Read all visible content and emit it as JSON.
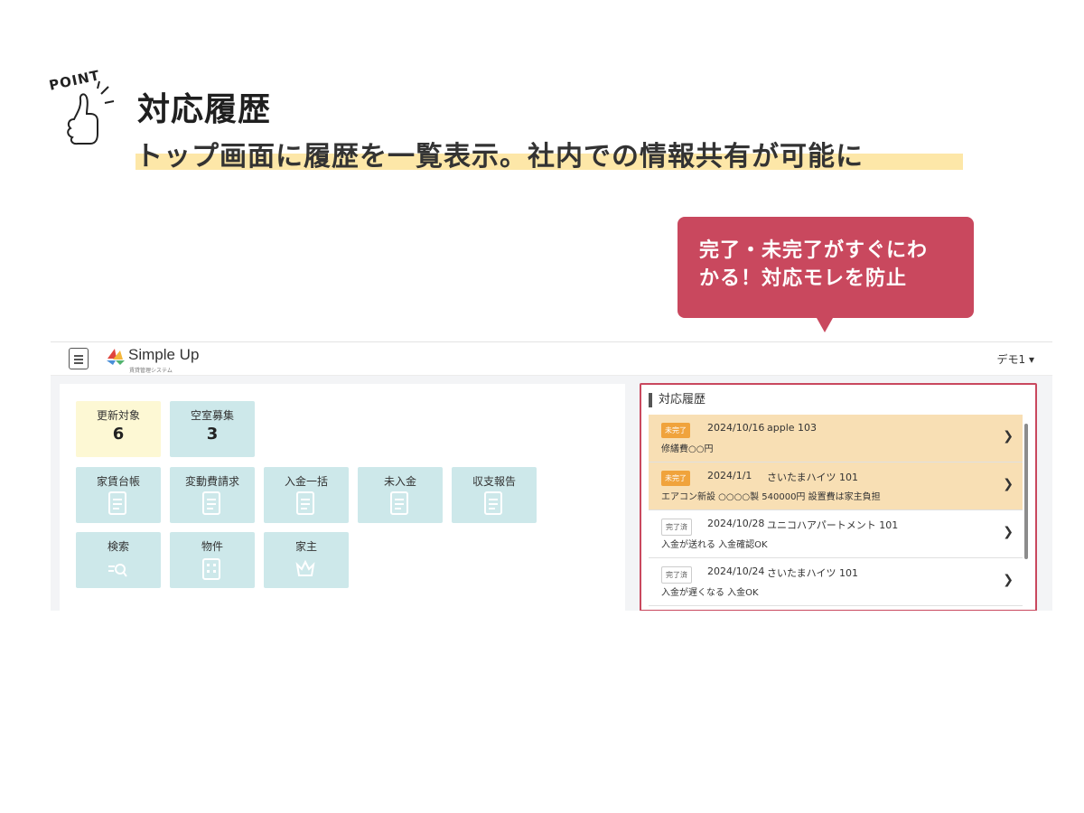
{
  "header": {
    "point_label": "POINT",
    "title": "対応履歴",
    "subtitle": "トップ画面に履歴を一覧表示。社内での情報共有が可能に"
  },
  "callout": {
    "text": "完了・未完了がすぐにわ\nかる！対応モレを防止"
  },
  "app": {
    "logo_name": "Simple Up",
    "logo_sub": "賃貸管理システム",
    "user_menu": "デモ1 ▾",
    "tiles": [
      {
        "label": "更新対象",
        "value": "6",
        "style": "yellow"
      },
      {
        "label": "空室募集",
        "value": "3",
        "style": "teal"
      },
      {
        "label": "家賃台帳",
        "icon": "document-icon"
      },
      {
        "label": "変動費請求",
        "icon": "document-icon"
      },
      {
        "label": "入金一括",
        "icon": "document-icon"
      },
      {
        "label": "未入金",
        "icon": "document-icon"
      },
      {
        "label": "収支報告",
        "icon": "document-icon"
      },
      {
        "label": "検索",
        "icon": "search-icon"
      },
      {
        "label": "物件",
        "icon": "building-icon"
      },
      {
        "label": "家主",
        "icon": "crown-icon"
      }
    ],
    "history": {
      "title": "対応履歴",
      "rows": [
        {
          "status": "未完了",
          "state": "pending",
          "date": "2024/10/16",
          "property": "apple  103",
          "note": "修繕費○○円"
        },
        {
          "status": "未完了",
          "state": "pending",
          "date": "2024/1/1",
          "property": "さいたまハイツ  101",
          "note": "エアコン新設 ○○○○製 540000円 設置費は家主負担"
        },
        {
          "status": "完了済",
          "state": "done",
          "date": "2024/10/28",
          "property": "ユニコハアパートメント  101",
          "note": "入金が送れる 入金確認OK"
        },
        {
          "status": "完了済",
          "state": "done",
          "date": "2024/10/24",
          "property": "さいたまハイツ  101",
          "note": "入金が遅くなる 入金OK"
        }
      ]
    }
  },
  "colors": {
    "accent": "#c9485e",
    "tile": "#cde8ea",
    "tile_highlight": "#fdf8d4",
    "pending_row": "#f8dfb4",
    "pending_badge": "#f0a33c",
    "subtitle_highlight": "#fde7a8"
  }
}
